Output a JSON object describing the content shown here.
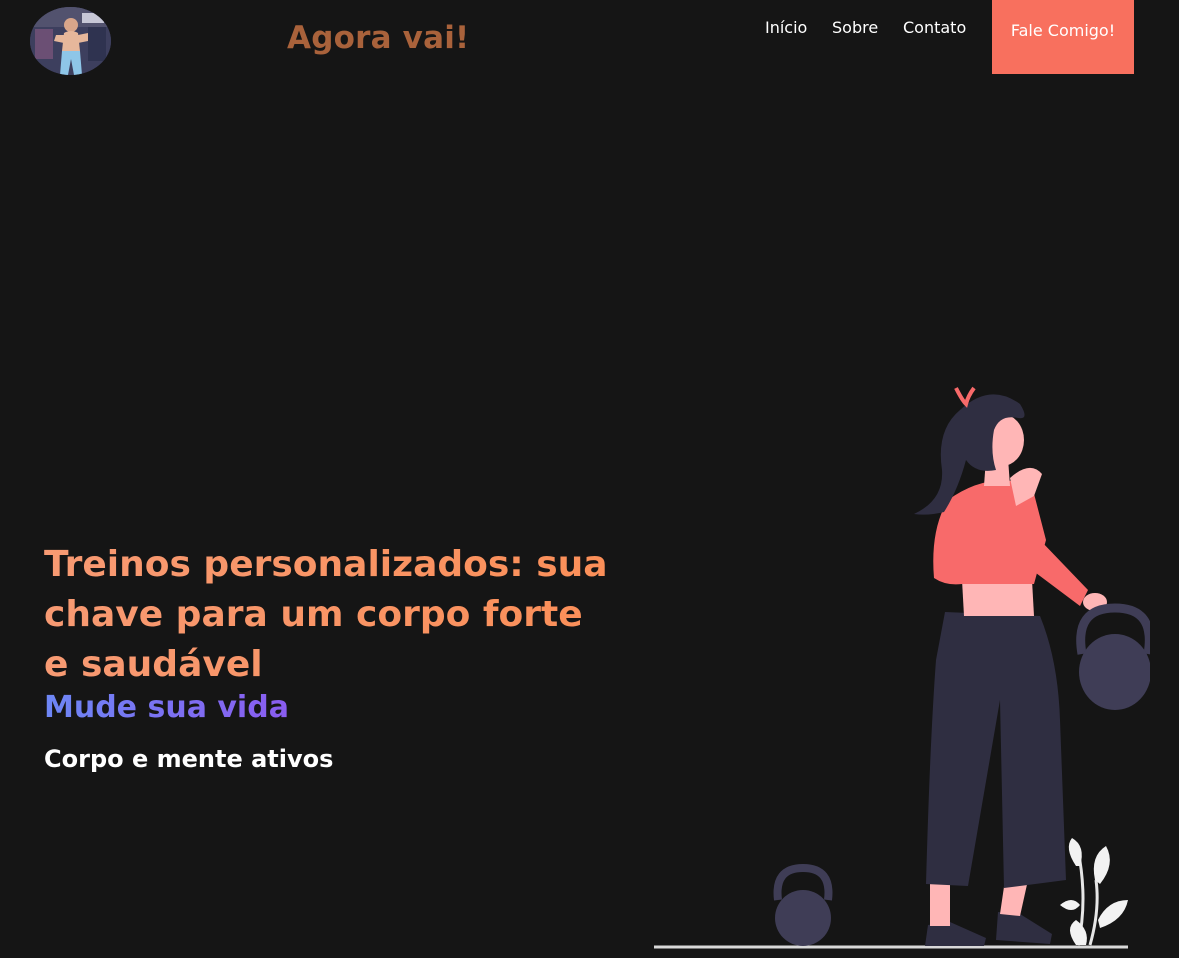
{
  "header": {
    "brand": "Agora vai!",
    "nav": [
      "Início",
      "Sobre",
      "Contato"
    ],
    "cta_label": "Fale Comigo!"
  },
  "hero": {
    "title": "Treinos personalizados: sua chave para um corpo forte e saudável",
    "subtitle": "Mude sua vida",
    "tagline": "Corpo e mente ativos"
  },
  "colors": {
    "background": "#151515",
    "brand": "#a9623b",
    "accent": "#f8705e",
    "title": "#fb9a65",
    "subtitle_gradient": [
      "#6d87f5",
      "#8a5cf0"
    ]
  }
}
